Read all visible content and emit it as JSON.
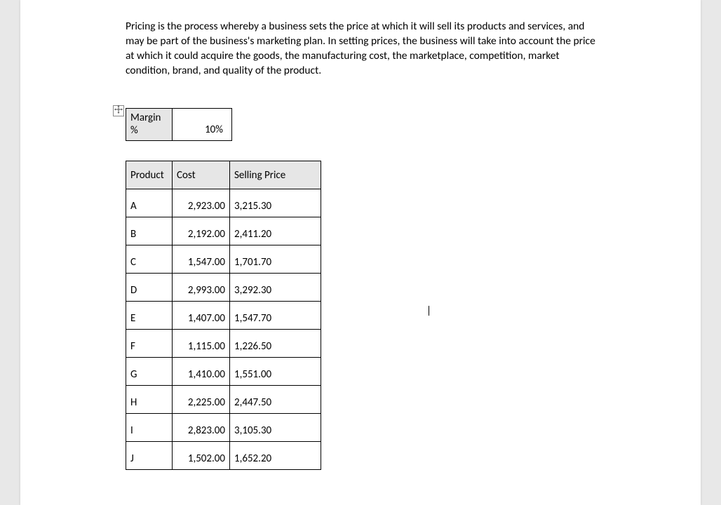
{
  "intro": "Pricing is the process whereby a business sets the price at which it will sell its products and services, and may be part of the business's marketing plan. In setting prices, the business will take into account the price at which it could acquire the goods, the manufacturing cost, the marketplace, competition, market condition, brand, and quality of the product.",
  "margin": {
    "label_line1": "Margin",
    "label_line2": "%",
    "value": "10%"
  },
  "headers": {
    "product": "Product",
    "cost": "Cost",
    "price": "Selling Price"
  },
  "rows": [
    {
      "product": "A",
      "cost": "2,923.00",
      "price": "3,215.30"
    },
    {
      "product": "B",
      "cost": "2,192.00",
      "price": "2,411.20"
    },
    {
      "product": "C",
      "cost": "1,547.00",
      "price": "1,701.70"
    },
    {
      "product": "D",
      "cost": "2,993.00",
      "price": "3,292.30"
    },
    {
      "product": "E",
      "cost": "1,407.00",
      "price": "1,547.70"
    },
    {
      "product": "F",
      "cost": "1,115.00",
      "price": "1,226.50"
    },
    {
      "product": "G",
      "cost": "1,410.00",
      "price": "1,551.00"
    },
    {
      "product": "H",
      "cost": "2,225.00",
      "price": "2,447.50"
    },
    {
      "product": "I",
      "cost": "2,823.00",
      "price": "3,105.30"
    },
    {
      "product": "J",
      "cost": "1,502.00",
      "price": "1,652.20"
    }
  ]
}
